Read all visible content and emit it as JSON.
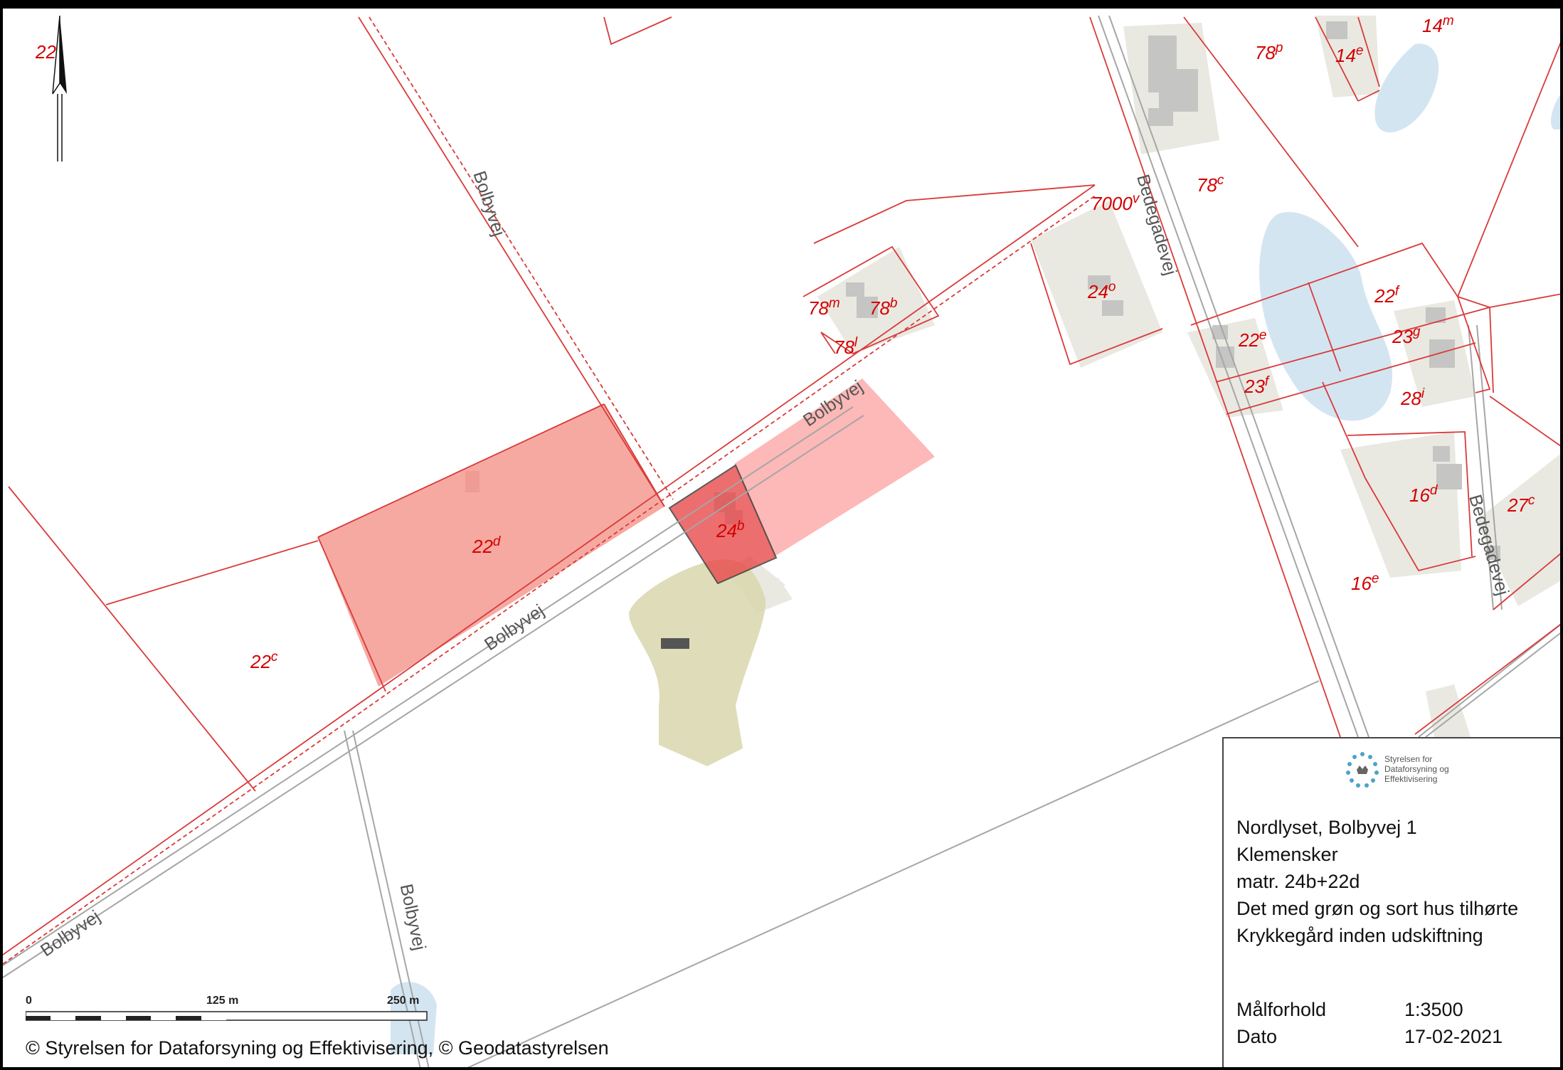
{
  "parcels": [
    "22",
    "78p",
    "14e",
    "14m",
    "78c",
    "7000v",
    "24o",
    "78m",
    "78b",
    "78l",
    "22f",
    "22e",
    "23g",
    "23f",
    "28i",
    "22d",
    "24b",
    "16d",
    "27c",
    "22c",
    "16e"
  ],
  "roads": [
    "Bolbyvej",
    "Bolbyvej",
    "Bolbyvej",
    "Bolbyvej",
    "Bolbyvej",
    "Bedegadevej",
    "Bedegadevej"
  ],
  "info": {
    "logo_line1": "Styrelsen for",
    "logo_line2": "Dataforsyning og",
    "logo_line3": "Effektivisering",
    "title": "Nordlyset, Bolbyvej 1",
    "place": "Klemensker",
    "matr": "matr. 24b+22d",
    "note1": "Det med grøn og sort hus tilhørte",
    "note2": "Krykkegård inden udskiftning",
    "scale_label": "Målforhold",
    "scale_value": "1:3500",
    "date_label": "Dato",
    "date_value": "17-02-2021"
  },
  "scalebar": {
    "tick0": "0",
    "tick1": "125 m",
    "tick2": "250 m"
  },
  "copyright": "© Styrelsen for Dataforsyning og Effektivisering, © Geodatastyrelsen",
  "colors": {
    "parcel_line": "#d93a3a",
    "highlight": "#f79a9a",
    "highlight_dark": "#e84a4a",
    "building_area": "#e9e9e2",
    "water": "#d3e5f1",
    "historic": "#d9d7ad"
  }
}
